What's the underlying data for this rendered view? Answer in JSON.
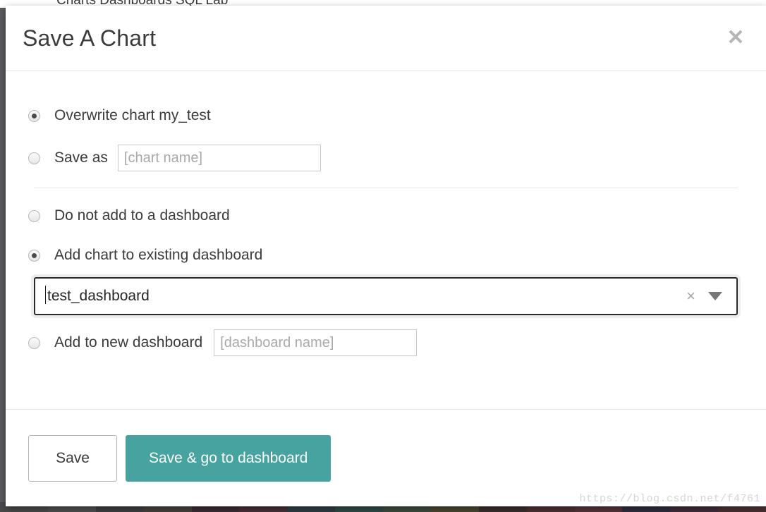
{
  "backdrop": {
    "navbar_ghost_text": "Charts          Dashboards          SQL Lab",
    "chart_strip_colors": [
      "#4a4a4a",
      "#4e4e4e",
      "#3e3e40",
      "#46403c",
      "#3b2d33",
      "#472f37",
      "#2e3b43",
      "#2f4a46",
      "#3d4a3c",
      "#4a4632",
      "#3a2e2e",
      "#4b3030",
      "#53343a",
      "#2f2d3d",
      "#402c3a",
      "#4a3030"
    ]
  },
  "modal": {
    "title": "Save A Chart",
    "close_label": "✕",
    "chart_options": [
      {
        "id": "overwrite",
        "label": "Overwrite chart my_test",
        "checked": true
      },
      {
        "id": "save_as",
        "label": "Save as",
        "checked": false
      }
    ],
    "chart_name_input": {
      "value": "",
      "placeholder": "[chart name]"
    },
    "dashboard_options": [
      {
        "id": "no_dashboard",
        "label": "Do not add to a dashboard",
        "checked": false
      },
      {
        "id": "existing_dashboard",
        "label": "Add chart to existing dashboard",
        "checked": true
      },
      {
        "id": "new_dashboard",
        "label": "Add to new dashboard",
        "checked": false
      }
    ],
    "dashboard_select": {
      "value": "test_dashboard",
      "clear_label": "×",
      "arrow_name": "chevron-down-icon"
    },
    "dashboard_name_input": {
      "value": "",
      "placeholder": "[dashboard name]"
    },
    "footer": {
      "save_label": "Save",
      "save_goto_label": "Save & go to dashboard",
      "primary_color": "#46a3a0"
    }
  },
  "watermark": "https://blog.csdn.net/f4761"
}
